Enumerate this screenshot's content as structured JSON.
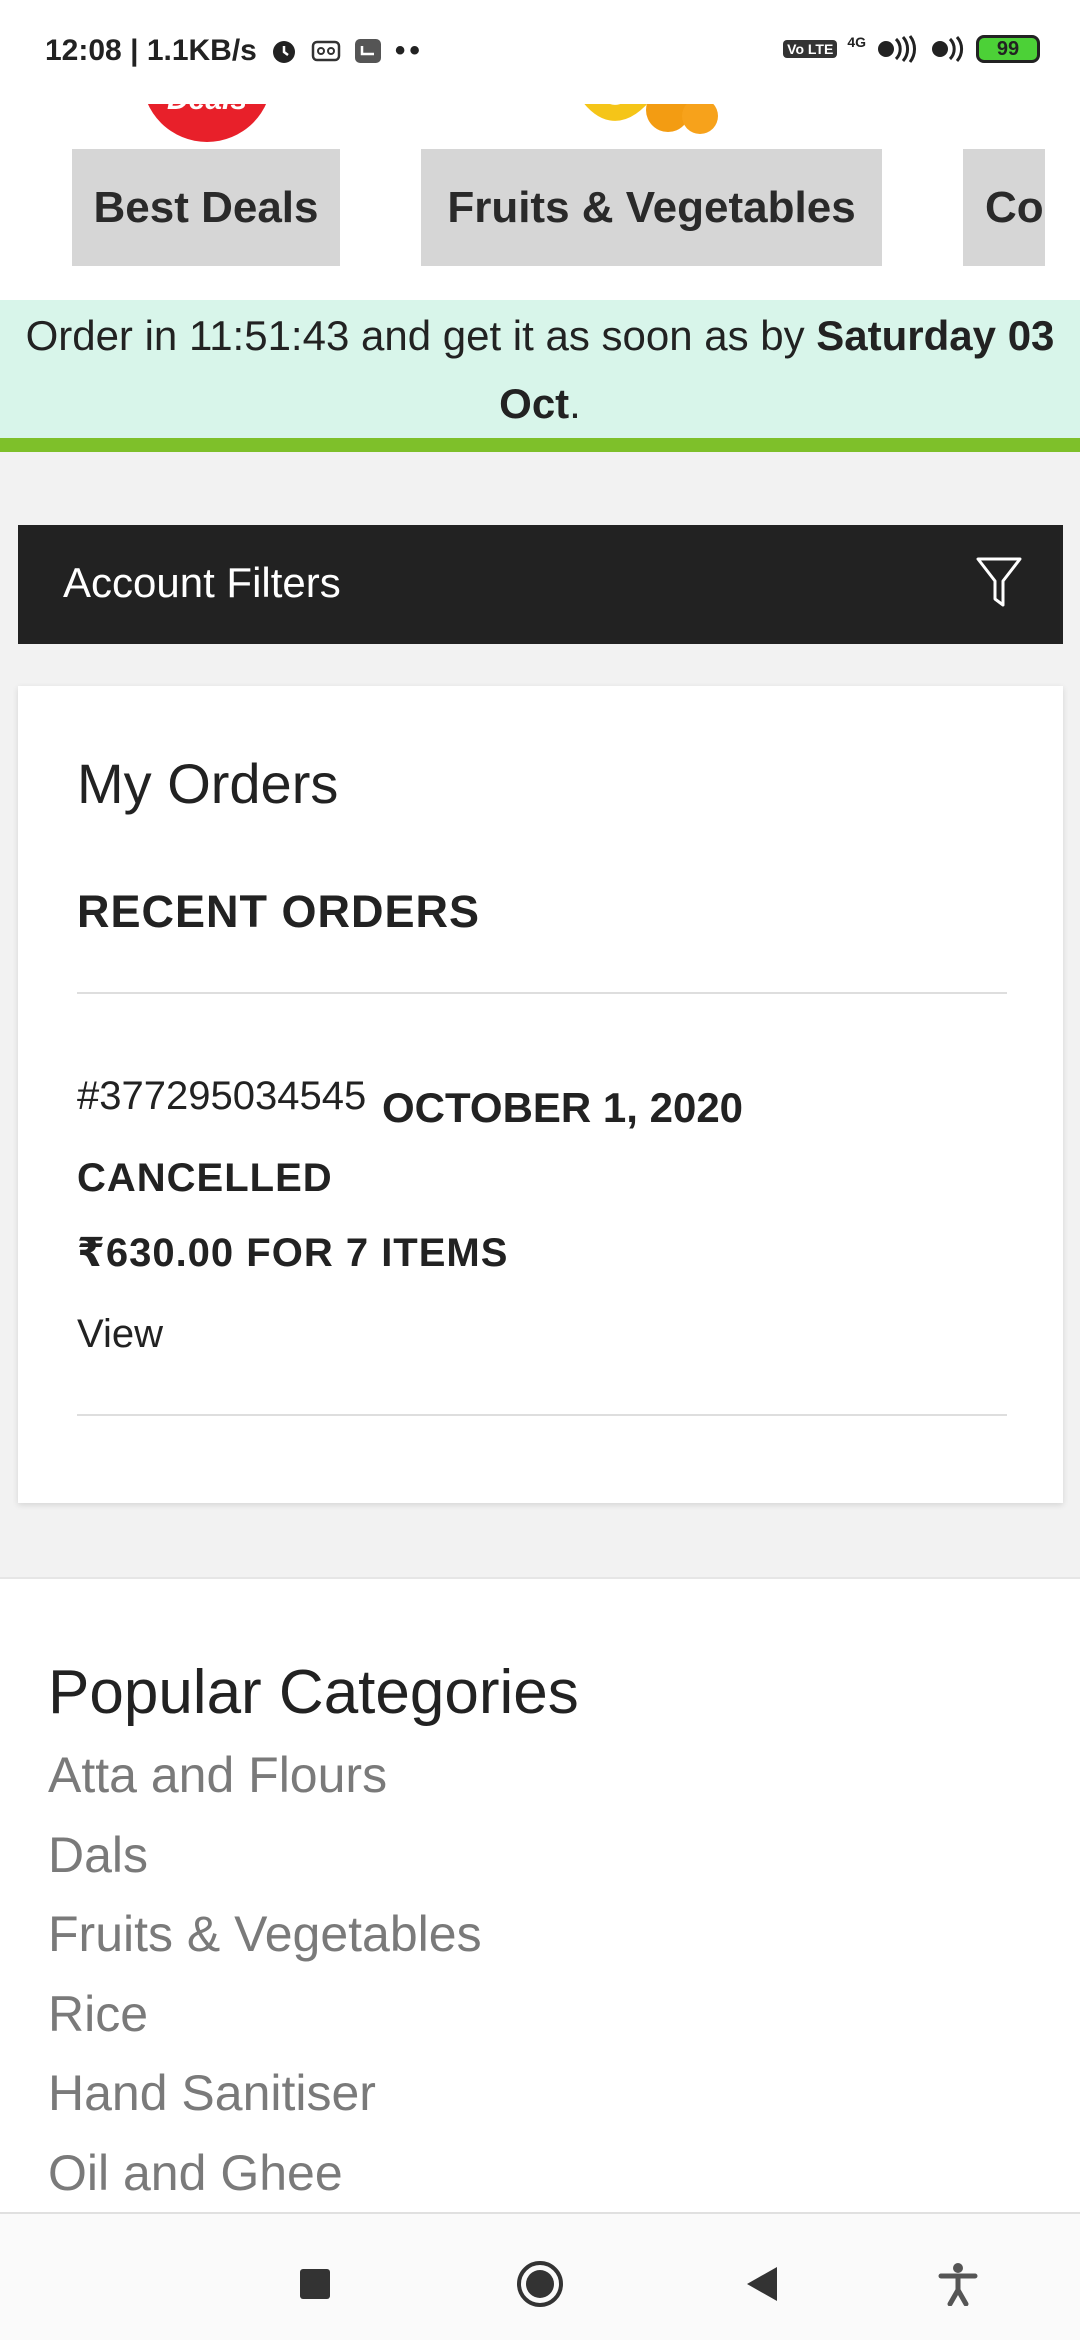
{
  "status_bar": {
    "time": "12:08",
    "network_speed": "1.1KB/s",
    "volte": "Vo LTE",
    "signal": "4G",
    "battery": "99"
  },
  "categories_strip": {
    "deals_image_text": "Deals",
    "items": [
      {
        "label": "Best Deals"
      },
      {
        "label": "Fruits & Vegetables"
      },
      {
        "label": "Co"
      }
    ]
  },
  "order_banner": {
    "prefix": "Order in 11:51:43 and get it as soon as by ",
    "date": "Saturday 03 Oct",
    "suffix": "."
  },
  "account_filters": {
    "label": "Account Filters",
    "icon": "filter-icon"
  },
  "my_orders": {
    "title": "My Orders",
    "recent_title": "RECENT ORDERS",
    "order": {
      "number": "#377295034545",
      "date": "OCTOBER 1, 2020",
      "status": "CANCELLED",
      "total": "₹630.00 FOR 7 ITEMS",
      "view_label": "View"
    }
  },
  "popular_categories": {
    "title": "Popular Categories",
    "items": [
      "Atta and Flours",
      "Dals",
      "Fruits & Vegetables",
      "Rice",
      "Hand Sanitiser",
      "Oil and Ghee"
    ]
  },
  "colors": {
    "banner_bg": "#d8f5ea",
    "banner_accent": "#7ec02a",
    "filters_bar": "#222222",
    "category_button": "#d6d6d6",
    "link_gray": "#7a7a7a"
  }
}
